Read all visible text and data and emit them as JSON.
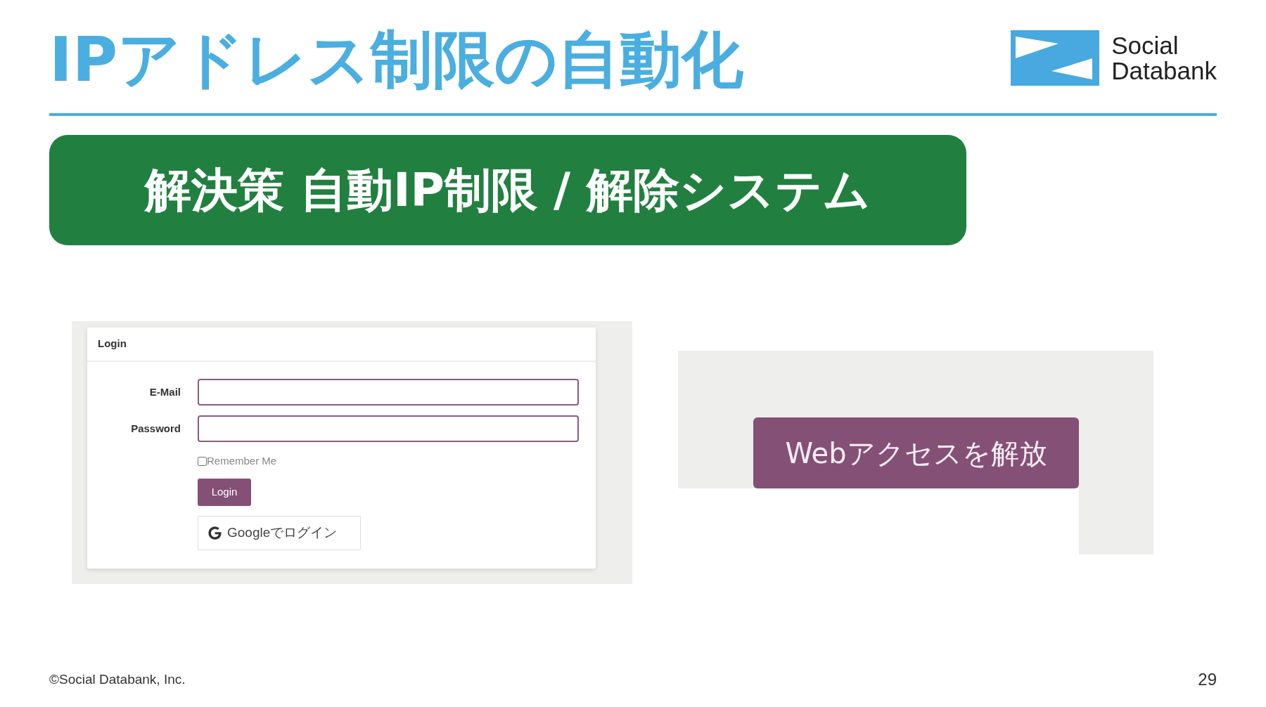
{
  "header": {
    "title": "IPアドレス制限の自動化",
    "logo": {
      "lines": [
        "Social",
        "Databank"
      ]
    }
  },
  "banner": {
    "text": "解決策 自動IP制限 / 解除システム"
  },
  "login_screenshot": {
    "card_title": "Login",
    "fields": [
      {
        "label": "E-Mail"
      },
      {
        "label": "Password"
      }
    ],
    "remember_me": {
      "label": "Remember Me",
      "checked": false
    },
    "login_button": "Login",
    "google_button": "Googleでログイン"
  },
  "web_access_screenshot": {
    "button": "Webアクセスを解放"
  },
  "footer": {
    "copyright": "©Social Databank, Inc.",
    "page_number": "29"
  }
}
